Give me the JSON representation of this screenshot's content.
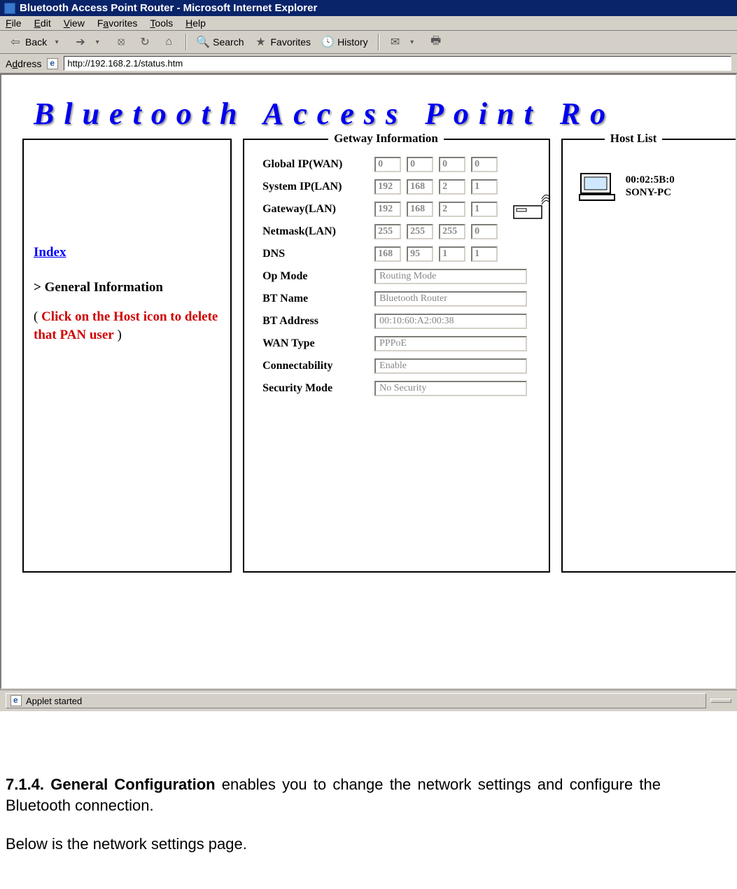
{
  "window": {
    "title": "Bluetooth Access Point Router - Microsoft Internet Explorer"
  },
  "menu": {
    "file": "File",
    "edit": "Edit",
    "view": "View",
    "favorites": "Favorites",
    "tools": "Tools",
    "help": "Help"
  },
  "toolbar": {
    "back": "Back",
    "search": "Search",
    "favorites": "Favorites",
    "history": "History"
  },
  "address": {
    "label": "Address",
    "url": "http://192.168.2.1/status.htm"
  },
  "banner": "Bluetooth  Access  Point  Ro",
  "sidebar": {
    "index": "Index",
    "general_info": ">  General Information",
    "hint_prefix": "( ",
    "hint_red": "Click on the Host icon to delete that PAN user",
    "hint_suffix": " )"
  },
  "gateway": {
    "legend": "Getway  Information",
    "labels": {
      "global_ip": "Global IP(WAN)",
      "system_ip": "System IP(LAN)",
      "gateway": "Gateway(LAN)",
      "netmask": "Netmask(LAN)",
      "dns": "DNS",
      "op_mode": "Op Mode",
      "bt_name": "BT Name",
      "bt_address": "BT Address",
      "wan_type": "WAN Type",
      "connectability": "Connectability",
      "security_mode": "Security Mode"
    },
    "global_ip": [
      "0",
      "0",
      "0",
      "0"
    ],
    "system_ip": [
      "192",
      "168",
      "2",
      "1"
    ],
    "gateway_ip": [
      "192",
      "168",
      "2",
      "1"
    ],
    "netmask": [
      "255",
      "255",
      "255",
      "0"
    ],
    "dns": [
      "168",
      "95",
      "1",
      "1"
    ],
    "op_mode": "Routing Mode",
    "bt_name": "Bluetooth Router",
    "bt_address": "00:10:60:A2:00:38",
    "wan_type": "PPPoE",
    "connectability": "Enable",
    "security_mode": "No Security"
  },
  "hostlist": {
    "legend": "Host  List",
    "host_mac": "00:02:5B:0",
    "host_name": "SONY-PC"
  },
  "status": {
    "text": "Applet started"
  },
  "doc": {
    "p1_bold": "7.1.4. General Configuration",
    "p1_rest": " enables you to change the network settings and configure the Bluetooth connection.",
    "p2": "Below is the network settings page."
  }
}
